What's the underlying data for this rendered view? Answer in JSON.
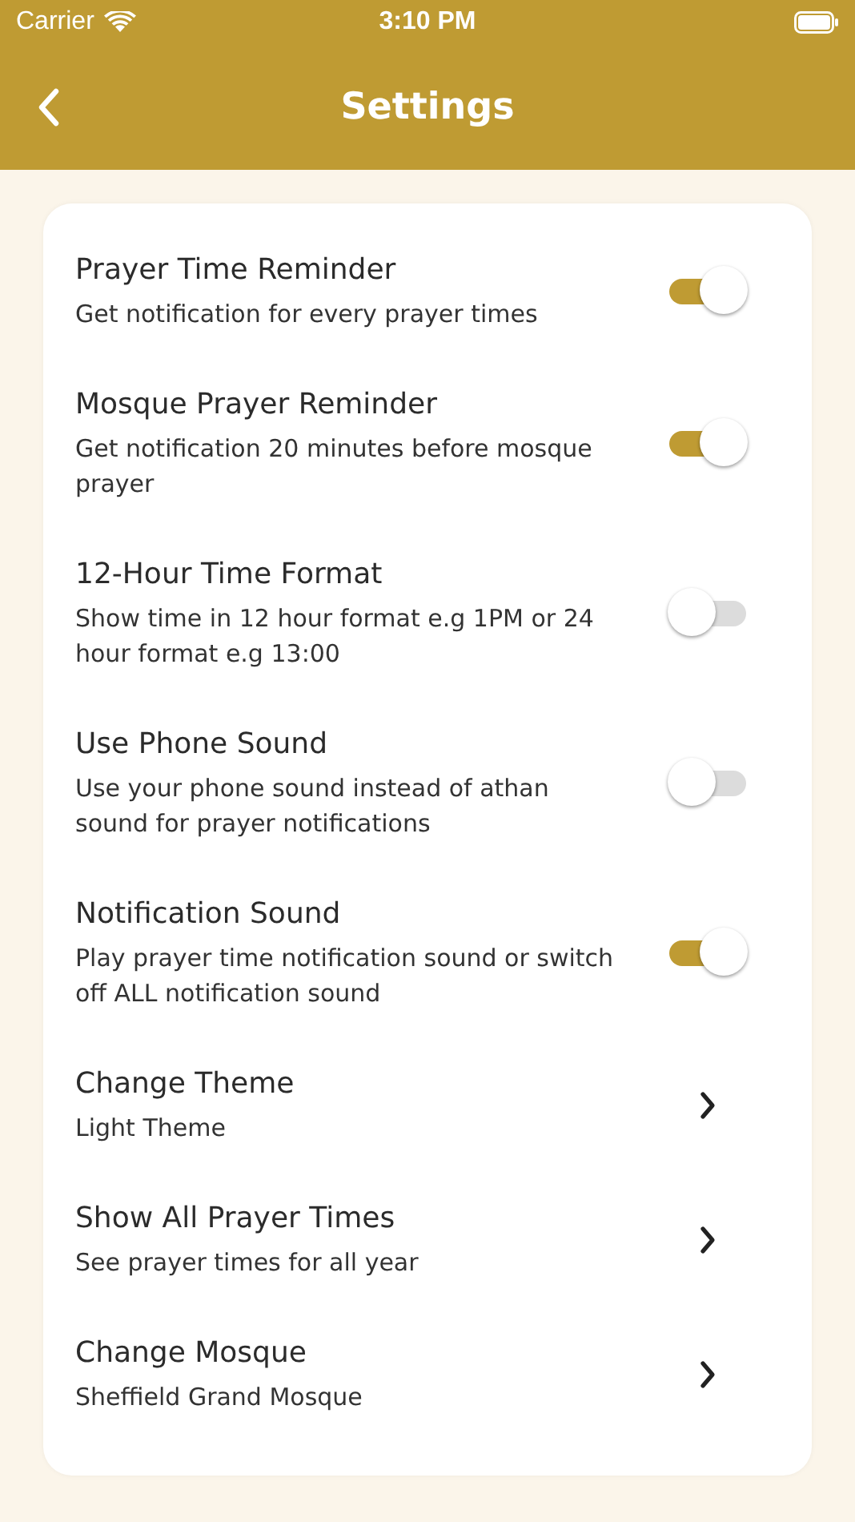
{
  "status_bar": {
    "carrier": "Carrier",
    "time": "3:10 PM"
  },
  "nav": {
    "title": "Settings"
  },
  "settings": [
    {
      "kind": "toggle",
      "title": "Prayer Time Reminder",
      "subtitle": "Get notification for every prayer times",
      "on": true
    },
    {
      "kind": "toggle",
      "title": "Mosque Prayer Reminder",
      "subtitle": "Get notification 20 minutes before mosque prayer",
      "on": true
    },
    {
      "kind": "toggle",
      "title": "12-Hour Time Format",
      "subtitle": "Show time in 12 hour format e.g 1PM or 24 hour format e.g 13:00",
      "on": false
    },
    {
      "kind": "toggle",
      "title": "Use Phone Sound",
      "subtitle": "Use your phone sound instead of athan sound for prayer notifications",
      "on": false
    },
    {
      "kind": "toggle",
      "title": "Notification Sound",
      "subtitle": "Play prayer time notification sound or switch off ALL notification sound",
      "on": true
    },
    {
      "kind": "link",
      "title": "Change Theme",
      "subtitle": "Light Theme"
    },
    {
      "kind": "link",
      "title": "Show All Prayer Times",
      "subtitle": "See prayer times for all year"
    },
    {
      "kind": "link",
      "title": "Change Mosque",
      "subtitle": "Sheffield Grand Mosque"
    }
  ]
}
